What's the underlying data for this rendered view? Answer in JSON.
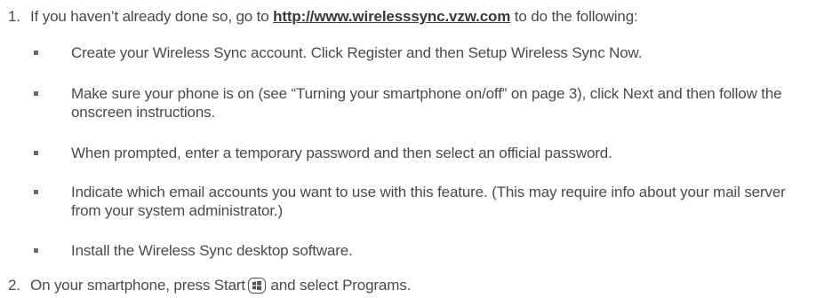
{
  "step1": {
    "number": "1.",
    "text_before": "If you haven’t already done so, go to ",
    "link": "http://www.wirelesssync.vzw.com",
    "text_after": " to do the following:"
  },
  "bullets": [
    "Create your Wireless Sync account. Click Register and then Setup Wireless Sync Now.",
    "Make sure your phone is on (see “Turning your smartphone on/off” on page 3), click Next and then follow the onscreen instructions.",
    "When prompted, enter a temporary password and then select an official password.",
    "Indicate which email accounts you want to use with this feature. (This may require info about your mail server from your system administrator.)",
    "Install the Wireless Sync desktop software."
  ],
  "step2": {
    "number": "2.",
    "text_before": "On your smartphone, press Start",
    "icon": "windows-start-icon",
    "text_after": " and select Programs."
  }
}
